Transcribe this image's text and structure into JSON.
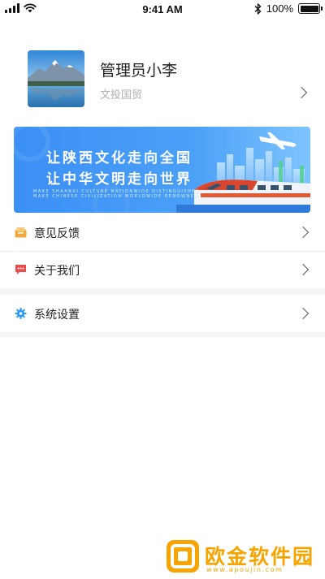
{
  "status_bar": {
    "time": "9:41 AM",
    "battery": "100%",
    "battery_level": 1.0,
    "icons": [
      "signal-icon",
      "wifi-icon",
      "bluetooth-icon",
      "battery-icon"
    ]
  },
  "profile": {
    "name": "管理员小李",
    "organization": "文投国贸"
  },
  "banner": {
    "line1": "让陕西文化走向全国",
    "line2": "让中华文明走向世界",
    "sub1": "MAKE SHAANXI CULTURE NATIONWIDE DISTINGUISHED",
    "sub2": "MAKE CHINESE CIVILIZATION WORLDWIDE RENOWNED"
  },
  "menu": [
    {
      "label": "意见反馈",
      "icon": "feedback-icon",
      "icon_color": "#f0a83c"
    },
    {
      "label": "关于我们",
      "icon": "message-icon",
      "icon_color": "#e84d4d"
    },
    {
      "label": "系统设置",
      "icon": "gear-icon",
      "icon_color": "#2b9af3"
    }
  ],
  "watermark": {
    "text": "欧金软件园",
    "url": "www.apoujin.com",
    "color": "#f7a400"
  }
}
